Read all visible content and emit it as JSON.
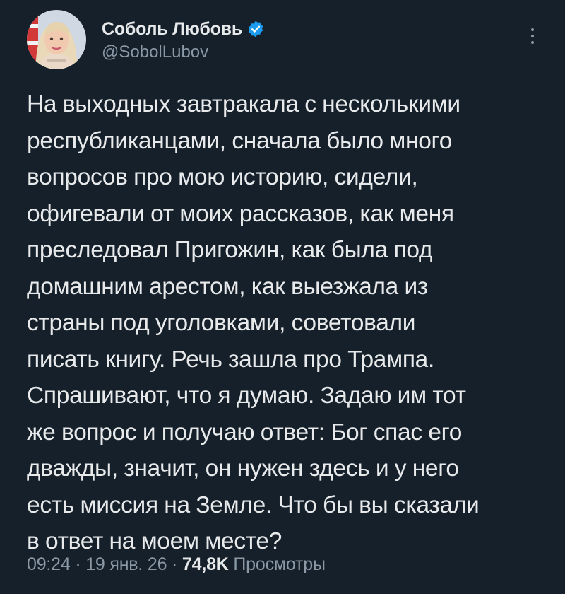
{
  "author": {
    "display_name": "Соболь Любовь",
    "handle": "@SobolLubov",
    "verified": true
  },
  "tweet": {
    "text": "На выходных завтракала с несколькими\nреспубликанцами, сначала было много\nвопросов про мою историю, сидели,\nофигевали от моих рассказов, как меня\nпреследовал Пригожин, как была под\nдомашним арестом, как выезжала из\nстраны под уголовками, советовали\nписать книгу. Речь зашла про Трампа.\nСпрашивают, что я думаю. Задаю им тот\nже вопрос и получаю ответ: Бог спас его\nдважды, значит, он нужен здесь и у него\nесть миссия на Земле. Что бы вы сказали\nв ответ на моем месте?"
  },
  "meta": {
    "time": "09:24",
    "date": "19 янв. 26",
    "separator": "·",
    "views_count": "74,8K",
    "views_label": "Просмотры"
  },
  "icons": {
    "verified": "verified-badge-icon",
    "more": "more-vertical-icon"
  },
  "colors": {
    "background": "#15202b",
    "text": "#e7e9ea",
    "secondary": "#8b98a5",
    "verified": "#1d9bf0"
  }
}
